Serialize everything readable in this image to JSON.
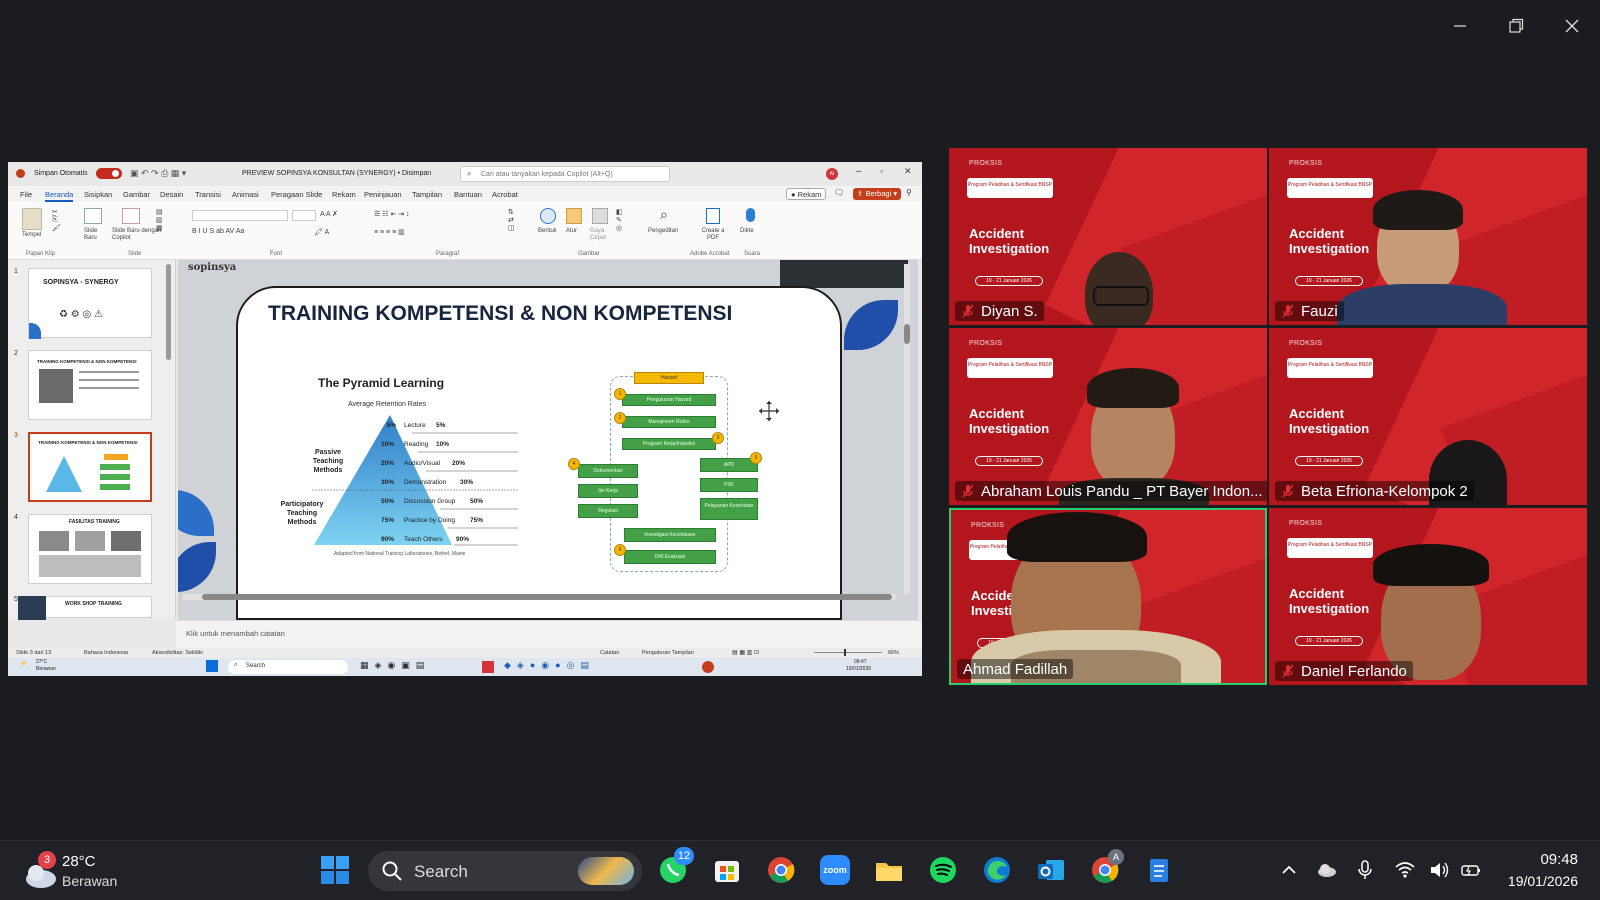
{
  "meeting": {
    "window_controls": {
      "minimize": "minimize",
      "restore": "restore",
      "close": "close"
    }
  },
  "ppt": {
    "autosave_label": "Simpan Otomatis",
    "doc_title": "PREVIEW SOPINSYA KONSULTAN (SYNERGY) • Disimpan",
    "search_placeholder": "Cari atau tanyakan kepada Copilot (Alt+Q)",
    "menu": [
      "File",
      "Beranda",
      "Sisipkan",
      "Gambar",
      "Desain",
      "Transisi",
      "Animasi",
      "Peragaan Slide",
      "Rekam",
      "Peninjauan",
      "Tampilan",
      "Bantuan",
      "Acrobat"
    ],
    "record_label": "Rekam",
    "share_label": "Berbagi",
    "ribbon": {
      "paste": "Tempel",
      "new_slide": "Slide Baru",
      "new_slide_copilot": "Slide Baru dengan Copilot",
      "group_clipboard": "Papan Klip",
      "group_slide": "Slide",
      "group_font": "Font",
      "group_paragraph": "Paragraf",
      "group_drawing": "Gambar",
      "group_acrobat": "Adobe Acrobat",
      "group_voice": "Suara",
      "shape": "Bentuk",
      "arrange": "Atur",
      "styles": "Gaya Cepat",
      "editing": "Pengeditan",
      "create_pdf": "Create a PDF",
      "dictate": "Dikte"
    },
    "thumbnails": [
      {
        "num": "1",
        "title": "SOPINSYA - SYNERGY"
      },
      {
        "num": "2",
        "title": "TRAINING KOMPETENSI & NON KOMPETENSI"
      },
      {
        "num": "3",
        "title": "TRAINING KOMPETENSI & NON KOMPETENSI"
      },
      {
        "num": "4",
        "title": "FASILITAS TRAINING"
      },
      {
        "num": "5",
        "title": "WORK SHOP TRAINING"
      }
    ],
    "slide": {
      "brand": "sopinsya",
      "title": "TRAINING KOMPETENSI & NON KOMPETENSI",
      "pyramid_title": "The Pyramid Learning",
      "pyramid_subtitle": "Average Retention Rates",
      "passive": "Passive Teaching Methods",
      "participatory": "Participatory Teaching Methods",
      "levels": [
        {
          "pct": "5%",
          "label": "Lecture",
          "val": "5%"
        },
        {
          "pct": "10%",
          "label": "Reading",
          "val": "10%"
        },
        {
          "pct": "20%",
          "label": "Audio/Visual",
          "val": "20%"
        },
        {
          "pct": "30%",
          "label": "Demonstration",
          "val": "30%"
        },
        {
          "pct": "50%",
          "label": "Discussion Group",
          "val": "50%"
        },
        {
          "pct": "75%",
          "label": "Practice by Doing",
          "val": "75%"
        },
        {
          "pct": "90%",
          "label": "Teach Others",
          "val": "90%"
        }
      ],
      "source": "Adapted from National Training Laboratories, Bethel, Maine",
      "flow": {
        "hazard": "Hazard",
        "pengukuran": "Pengukuran Hazard",
        "manajemen": "Manajemen Risiko",
        "program": "Program Kerja/Inspeksi",
        "dokumentasi": "Dokumentasi",
        "izin": "Ijin Kerja",
        "regulasi": "Regulasi",
        "apd": "APD",
        "p3k": "P3K",
        "pelayanan": "Pelayanan Kesehatan",
        "investigasi": "Investigasi Kecelakaan",
        "drill": "Drill Evakuasi",
        "n1": "1",
        "n2": "2",
        "n3": "3",
        "n4": "4",
        "n5": "5",
        "n6": "6"
      }
    },
    "notes_placeholder": "Klik untuk menambah catatan",
    "status": {
      "slide": "Slide 3 dari 13",
      "language": "Bahasa Indonesia",
      "accessibility": "Aksesibilitas: Selidiki",
      "notes": "Catatan",
      "view_settings": "Pengaturan Tampilan",
      "zoom": "66%"
    },
    "inner_taskbar": {
      "temp": "27°C",
      "weather": "Berawan",
      "search": "Search",
      "time": "09:47",
      "date": "19/01/2026"
    }
  },
  "tiles": [
    {
      "name": "Diyan S.",
      "muted": true
    },
    {
      "name": "Fauzi",
      "muted": true
    },
    {
      "name": "Abraham Louis Pandu _ PT Bayer Indon...",
      "muted": true
    },
    {
      "name": "Beta Efriona-Kelompok 2",
      "muted": true
    },
    {
      "name": "Ahmad Fadillah",
      "muted": false,
      "active": true
    },
    {
      "name": "Daniel Ferlando",
      "muted": true
    }
  ],
  "tile_content": {
    "brand": "PROKSIS",
    "program": "Program Pelatihan & Sertifikasi BNSP",
    "line1": "Accident",
    "line2": "Investigation",
    "date": "19 - 21 Januari 2026"
  },
  "taskbar": {
    "weather_badge": "3",
    "temp": "28°C",
    "weather": "Berawan",
    "search": "Search",
    "whatsapp_badge": "12",
    "chrome_badge": "A",
    "zoom_label": "zoom",
    "time": "09:48",
    "date": "19/01/2026"
  },
  "colors": {
    "accent_green": "#2ecc71",
    "tile_red": "#b4161e",
    "zoom_blue": "#2d8cff",
    "muted_red": "#e02f2f"
  }
}
